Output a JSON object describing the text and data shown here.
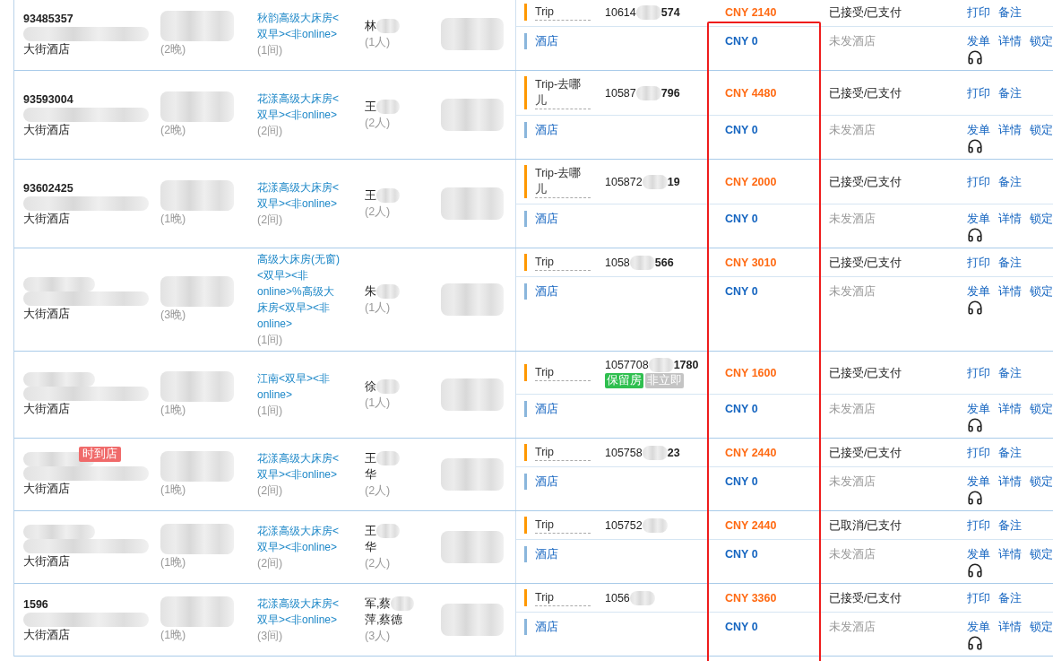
{
  "orders": [
    {
      "order_id": "93485357",
      "hotel": "大街酒店",
      "nights": "(2晚)",
      "room_type": "秋韵高级大床房<双早><非online>",
      "rooms": "(1间)",
      "guest": "林",
      "guest_count": "(1人)",
      "supplier": {
        "kind": "channel",
        "channel": "Trip",
        "order_prefix": "10614",
        "order_suffix": "574",
        "price": "CNY 2140",
        "status": "已接受/已支付",
        "actions": [
          "打印",
          "备注"
        ]
      },
      "hotel_line": {
        "kind": "hotel",
        "channel": "酒店",
        "price": "CNY 0",
        "status": "未发酒店",
        "actions": [
          "发单",
          "详情",
          "锁定"
        ]
      }
    },
    {
      "order_id": "93593004",
      "hotel": "大街酒店",
      "nights": "(2晚)",
      "room_type": "花漾高级大床房<双早><非online>",
      "rooms": "(2间)",
      "guest": "王",
      "guest_count": "(2人)",
      "supplier": {
        "kind": "channel",
        "channel": "Trip-去哪儿",
        "order_prefix": "10587",
        "order_suffix": "796",
        "price": "CNY 4480",
        "status": "已接受/已支付",
        "actions": [
          "打印",
          "备注"
        ]
      },
      "hotel_line": {
        "kind": "hotel",
        "channel": "酒店",
        "price": "CNY 0",
        "status": "未发酒店",
        "actions": [
          "发单",
          "详情",
          "锁定"
        ]
      }
    },
    {
      "order_id": "93602425",
      "hotel": "大街酒店",
      "nights": "(1晚)",
      "room_type": "花漾高级大床房<双早><非online>",
      "rooms": "(2间)",
      "guest": "王",
      "guest_count": "(2人)",
      "supplier": {
        "kind": "channel",
        "channel": "Trip-去哪儿",
        "order_prefix": "105872",
        "order_suffix": "19",
        "price": "CNY 2000",
        "status": "已接受/已支付",
        "actions": [
          "打印",
          "备注"
        ]
      },
      "hotel_line": {
        "kind": "hotel",
        "channel": "酒店",
        "price": "CNY 0",
        "status": "未发酒店",
        "actions": [
          "发单",
          "详情",
          "锁定"
        ]
      }
    },
    {
      "hotel": "大街酒店",
      "nights": "(3晚)",
      "room_type": "高级大床房(无窗)<双早><非online>%高级大床房<双早><非online>",
      "rooms": "(1间)",
      "guest": "朱",
      "guest_count": "(1人)",
      "supplier": {
        "kind": "channel",
        "channel": "Trip",
        "order_prefix": "1058",
        "order_suffix": "566",
        "price": "CNY 3010",
        "status": "已接受/已支付",
        "actions": [
          "打印",
          "备注"
        ]
      },
      "hotel_line": {
        "kind": "hotel",
        "channel": "酒店",
        "price": "CNY 0",
        "status": "未发酒店",
        "actions": [
          "发单",
          "详情",
          "锁定"
        ]
      }
    },
    {
      "hotel": "大街酒店",
      "nights": "(1晚)",
      "room_type": "江南<双早><非online>",
      "rooms": "(1间)",
      "guest": "徐",
      "guest_count": "(1人)",
      "supplier": {
        "kind": "channel",
        "channel": "Trip",
        "order_prefix": "1057708",
        "order_suffix": "1780",
        "tags": [
          {
            "label": "保留房",
            "color": "#2fbf4f"
          },
          {
            "label": "非立即",
            "color": "#c4c4c4"
          }
        ],
        "price": "CNY 1600",
        "status": "已接受/已支付",
        "actions": [
          "打印",
          "备注"
        ]
      },
      "hotel_line": {
        "kind": "hotel",
        "channel": "酒店",
        "price": "CNY 0",
        "status": "未发酒店",
        "actions": [
          "发单",
          "详情",
          "锁定"
        ]
      }
    },
    {
      "badge": "时到店",
      "hotel": "大街酒店",
      "nights": "(1晚)",
      "room_type": "花漾高级大床房<双早><非online>",
      "rooms": "(2间)",
      "guest": "王",
      "guest_extra": "华",
      "guest_count": "(2人)",
      "supplier": {
        "kind": "channel",
        "channel": "Trip",
        "order_prefix": "105758",
        "order_suffix": "23",
        "price": "CNY 2440",
        "status": "已接受/已支付",
        "actions": [
          "打印",
          "备注"
        ]
      },
      "hotel_line": {
        "kind": "hotel",
        "channel": "酒店",
        "price": "CNY 0",
        "status": "未发酒店",
        "actions": [
          "发单",
          "详情",
          "锁定"
        ]
      }
    },
    {
      "hotel": "大街酒店",
      "nights": "(1晚)",
      "room_type": "花漾高级大床房<双早><非online>",
      "rooms": "(2间)",
      "guest": "王",
      "guest_extra": "华",
      "guest_count": "(2人)",
      "supplier": {
        "kind": "channel",
        "channel": "Trip",
        "order_prefix": "105752",
        "price": "CNY 2440",
        "status": "已取消/已支付",
        "actions": [
          "打印",
          "备注"
        ]
      },
      "hotel_line": {
        "kind": "hotel",
        "channel": "酒店",
        "price": "CNY 0",
        "status": "未发酒店",
        "actions": [
          "发单",
          "详情",
          "锁定"
        ]
      }
    },
    {
      "order_id": "1596",
      "hotel": "大街酒店",
      "nights": "(1晚)",
      "room_type": "花漾高级大床房<双早><非online>",
      "rooms": "(3间)",
      "guest": "军,蔡",
      "guest_extra": "萍,蔡德",
      "guest_count": "(3人)",
      "supplier": {
        "kind": "channel",
        "channel": "Trip",
        "order_prefix": "1056",
        "price": "CNY 3360",
        "status": "已接受/已支付",
        "actions": [
          "打印",
          "备注"
        ]
      },
      "hotel_line": {
        "kind": "hotel",
        "channel": "酒店",
        "price": "CNY 0",
        "status": "未发酒店",
        "actions": [
          "发单",
          "详情",
          "锁定"
        ]
      }
    }
  ]
}
